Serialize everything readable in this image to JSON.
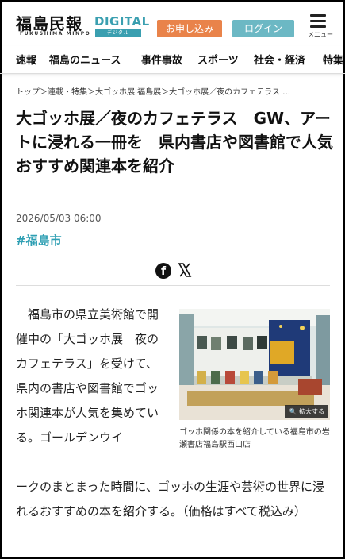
{
  "header": {
    "logo": "福島民報",
    "logo_digital": "DIGITAL",
    "logo_romaji": "FUKUSHIMA MINPO",
    "logo_digital_jp": "デジタル",
    "subscribe_label": "お申し込み",
    "login_label": "ログイン",
    "menu_label": "メニュー"
  },
  "nav": {
    "items": [
      {
        "label": "速報"
      },
      {
        "label": "福島のニュース"
      },
      {
        "label": "事件事故"
      },
      {
        "label": "スポーツ"
      },
      {
        "label": "社会・経済"
      },
      {
        "label": "特集"
      }
    ]
  },
  "article": {
    "breadcrumb": "トップ＞連載・特集＞大ゴッホ展 福島展＞大ゴッホ展／夜のカフェテラス …",
    "title": "大ゴッホ展／夜のカフェテラス　GW、アートに浸れる一冊を　県内書店や図書館で人気　おすすめ関連本を紹介",
    "date": "2026/05/03 06:00",
    "tag": "#福島市",
    "lede": "福島市の県立美術館で開催中の「大ゴッホ展　夜のカフェテラス」を受けて、県内の書店や図書館でゴッホ関連本が人気を集めている。ゴールデンウイ",
    "body_rest": "ークのまとまった時間に、ゴッホの生涯や芸術の世界に浸れるおすすめの本を紹介する。（価格はすべて税込み）",
    "photo_zoom_label": "拡大する",
    "photo_caption": "ゴッホ関係の本を紹介している福島市の岩瀬書店福島駅西口店"
  },
  "colors": {
    "accent": "#2e9fb3",
    "subscribe": "#e9834a",
    "login": "#6cb8c4"
  }
}
